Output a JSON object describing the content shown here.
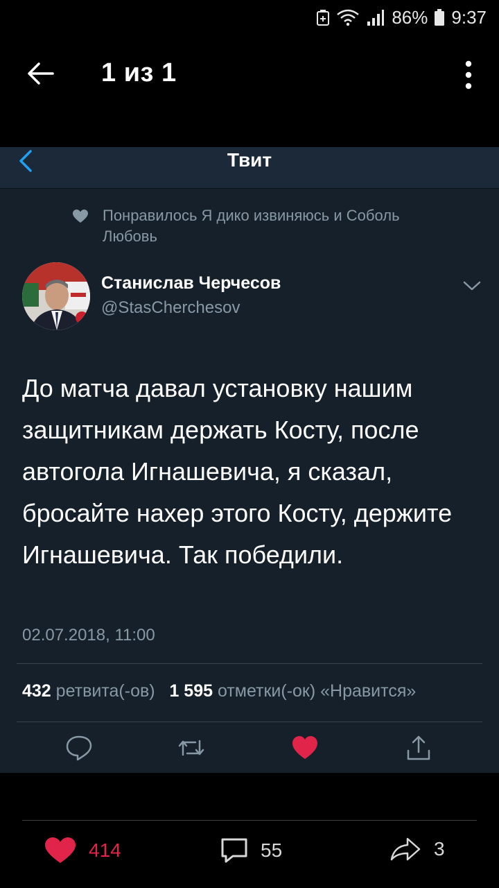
{
  "status_bar": {
    "battery": "86%",
    "time": "9:37"
  },
  "viewer": {
    "title": "1 из 1"
  },
  "tweet": {
    "header_title": "Твит",
    "liked_by": "Понравилось Я дико извиняюсь и Соболь Любовь",
    "author_name": "Станислав Черчесов",
    "author_handle": "@StasCherchesov",
    "text": "До матча давал установку нашим защитникам держать Косту, после автогола Игнашевича, я сказал, бросайте нахер этого Косту, держите Игнашевича. Так победили.",
    "timestamp": "02.07.2018, 11:00",
    "retweet_count": "432",
    "retweet_label": "ретвита(-ов)",
    "like_count": "1 595",
    "like_label": "отметки(-ок) «Нравится»",
    "colors": {
      "background": "#15202b",
      "header": "#1c2938",
      "muted": "#8899a6",
      "liked_heart": "#e0244a"
    }
  },
  "bottom_bar": {
    "likes": "414",
    "comments": "55",
    "shares": "3",
    "colors": {
      "like": "#e0244a"
    }
  }
}
